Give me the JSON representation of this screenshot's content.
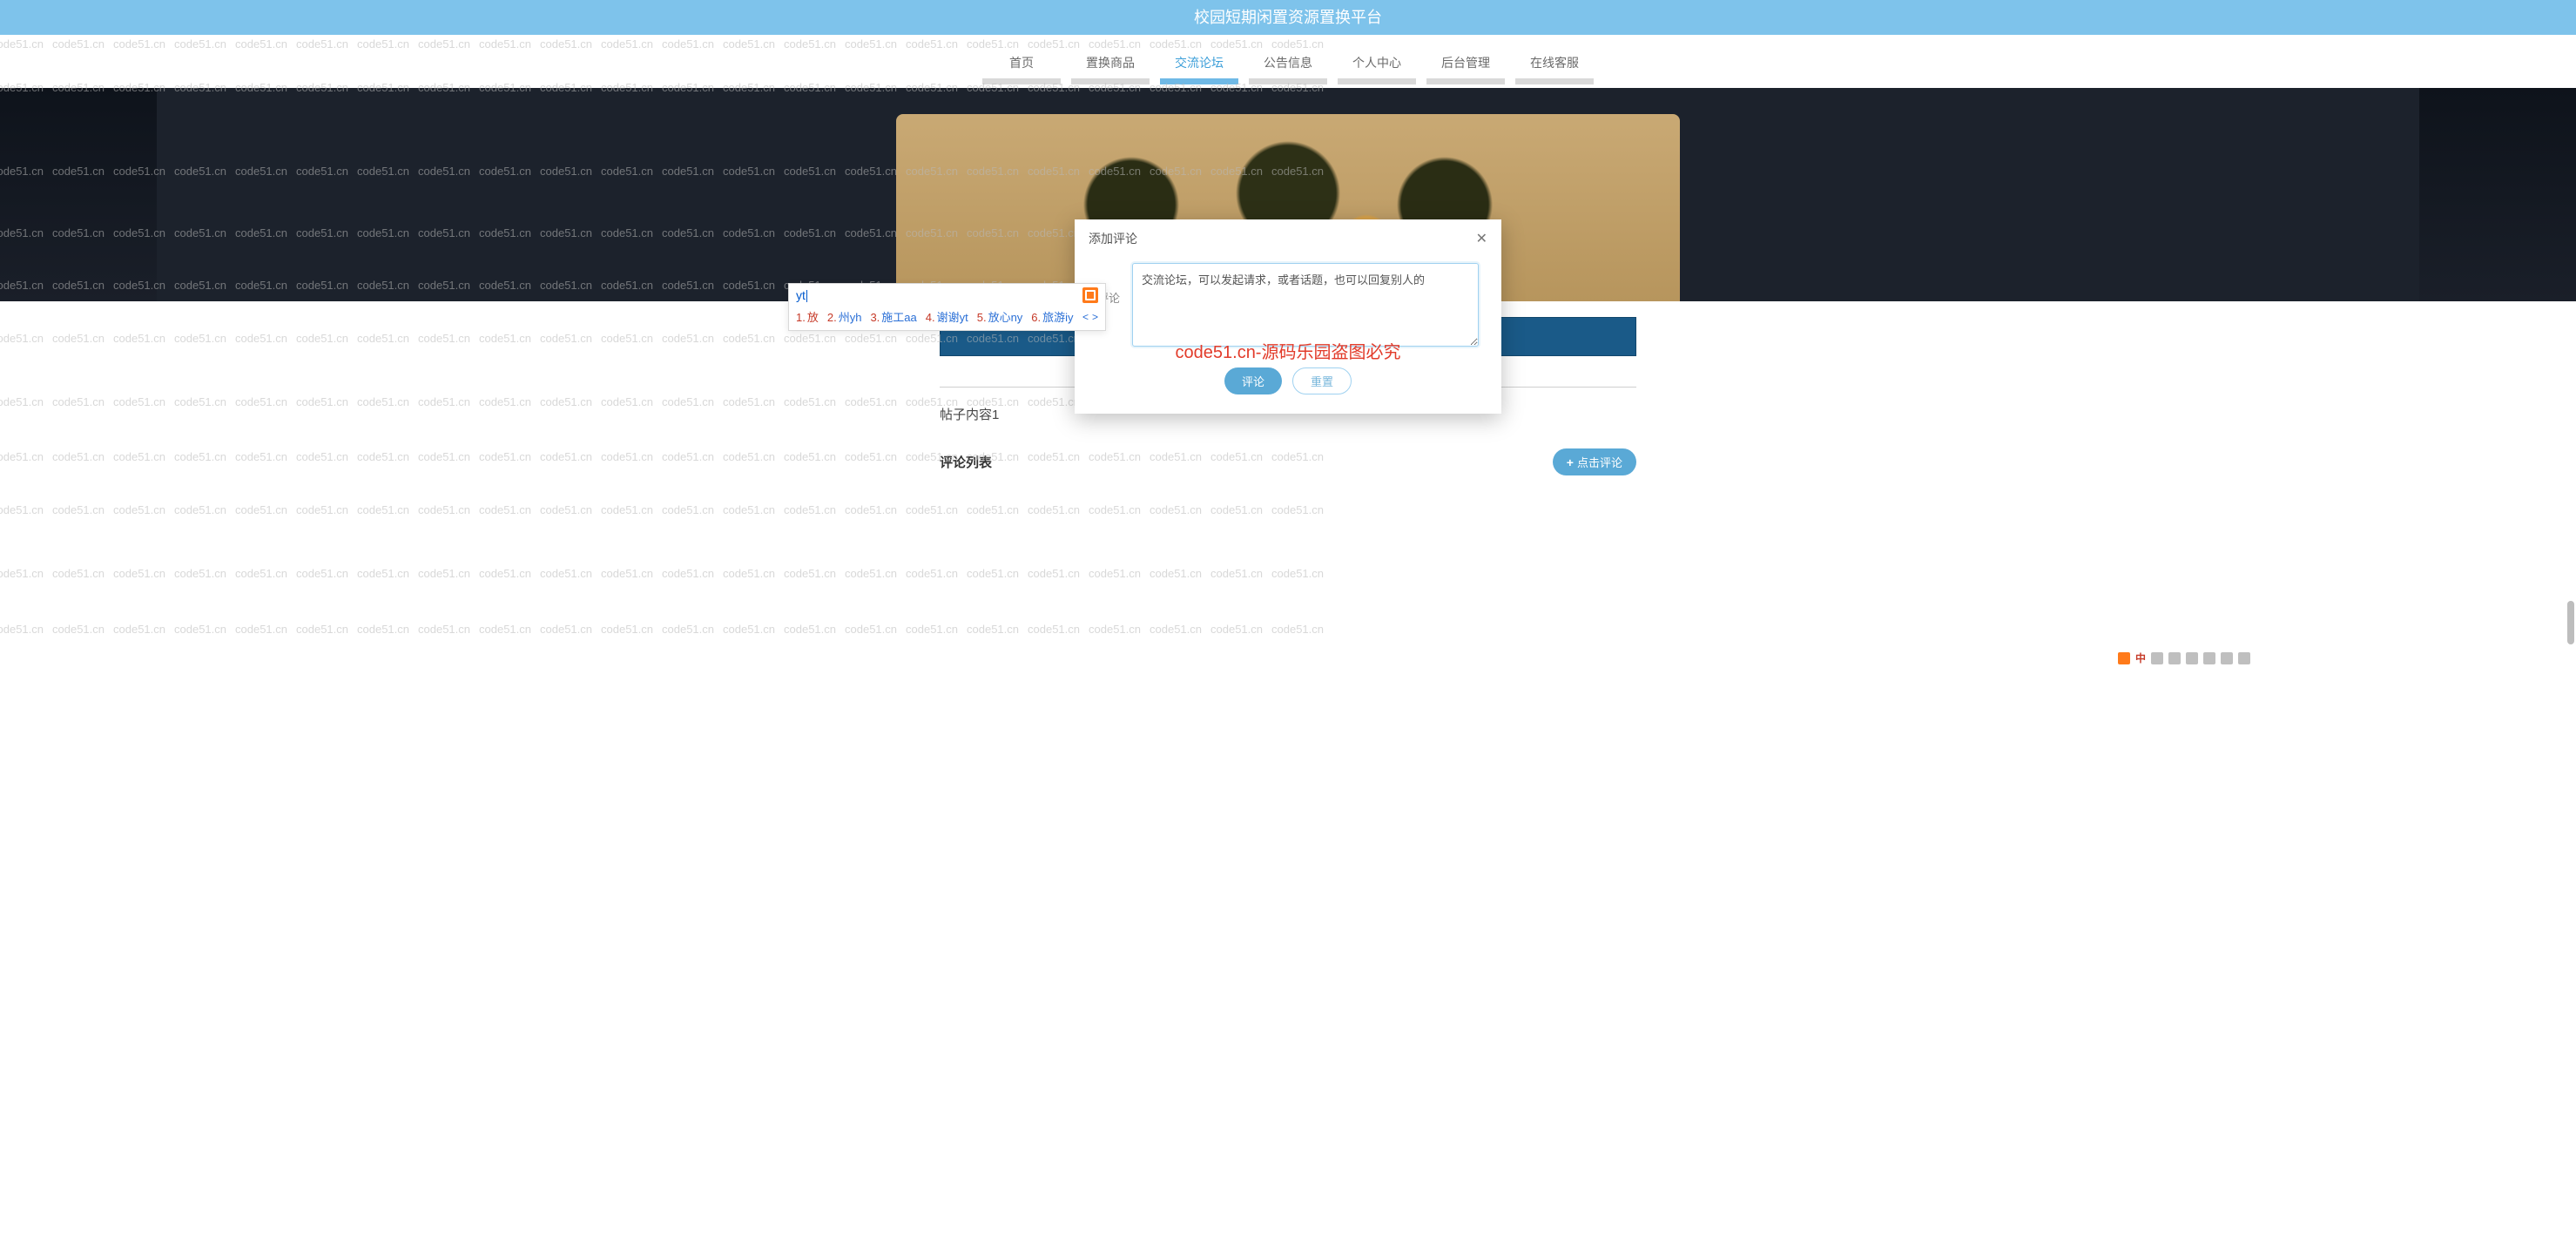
{
  "banner": {
    "title": "校园短期闲置资源置换平台"
  },
  "nav": {
    "items": [
      {
        "label": "首页"
      },
      {
        "label": "置换商品"
      },
      {
        "label": "交流论坛",
        "active": true
      },
      {
        "label": "公告信息"
      },
      {
        "label": "个人中心"
      },
      {
        "label": "后台管理"
      },
      {
        "label": "在线客服"
      }
    ]
  },
  "post": {
    "body": "帖子内容1"
  },
  "comments": {
    "title": "评论列表",
    "add_button": "点击评论"
  },
  "modal": {
    "title": "添加评论",
    "field_label": "评论",
    "textarea_value": "交流论坛，可以发起请求，或者话题，也可以回复别人的",
    "submit": "评论",
    "reset": "重置"
  },
  "ime": {
    "typed": "yt",
    "candidates": [
      {
        "index": "1.",
        "word": "放",
        "selected": true
      },
      {
        "index": "2.",
        "word": "州yh"
      },
      {
        "index": "3.",
        "word": "施工aa"
      },
      {
        "index": "4.",
        "word": "谢谢yt"
      },
      {
        "index": "5.",
        "word": "放心ny"
      },
      {
        "index": "6.",
        "word": "旅游iy"
      }
    ]
  },
  "overlay_red": "code51.cn-源码乐园盗图必究",
  "watermark_text": "code51.cn",
  "status_strip": {
    "char": "中"
  }
}
